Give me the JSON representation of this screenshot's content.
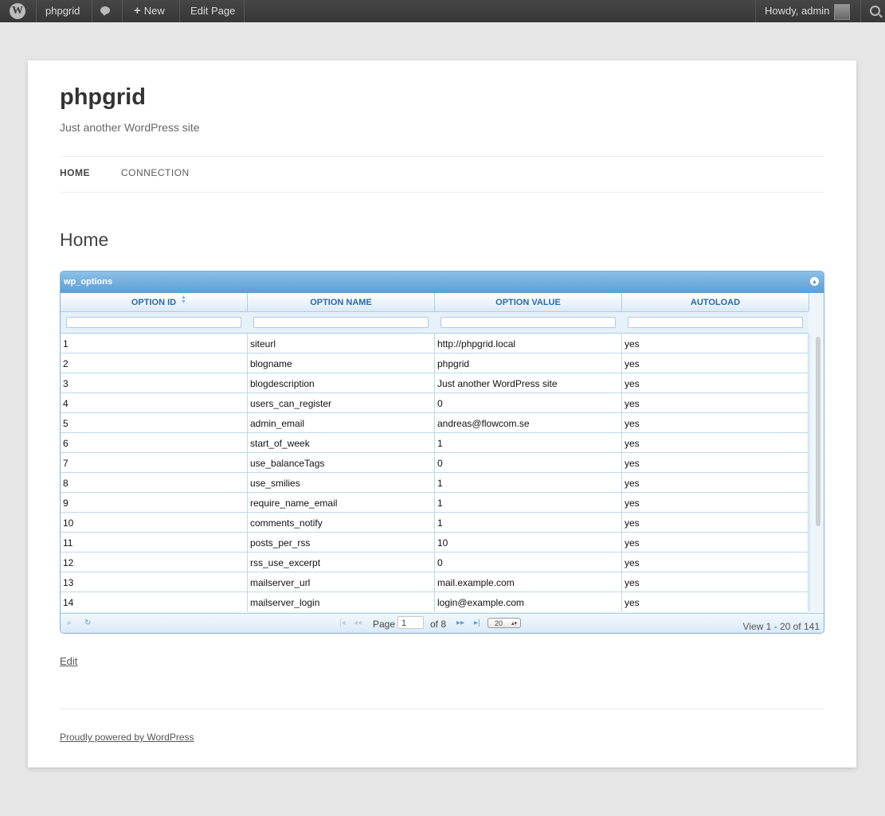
{
  "adminbar": {
    "site_name": "phpgrid",
    "new_label": "New",
    "edit_label": "Edit Page",
    "howdy_label": "Howdy, admin"
  },
  "site": {
    "title": "phpgrid",
    "description": "Just another WordPress site"
  },
  "nav": {
    "items": [
      "HOME",
      "CONNECTION"
    ]
  },
  "page": {
    "title": "Home",
    "edit_link": "Edit",
    "footer_text": "Proudly powered by WordPress"
  },
  "grid": {
    "caption": "wp_options",
    "columns": [
      "OPTION ID",
      "OPTION NAME",
      "OPTION VALUE",
      "AUTOLOAD"
    ],
    "rows": [
      [
        "1",
        "siteurl",
        "http://phpgrid.local",
        "yes"
      ],
      [
        "2",
        "blogname",
        "phpgrid",
        "yes"
      ],
      [
        "3",
        "blogdescription",
        "Just another WordPress site",
        "yes"
      ],
      [
        "4",
        "users_can_register",
        "0",
        "yes"
      ],
      [
        "5",
        "admin_email",
        "andreas@flowcom.se",
        "yes"
      ],
      [
        "6",
        "start_of_week",
        "1",
        "yes"
      ],
      [
        "7",
        "use_balanceTags",
        "0",
        "yes"
      ],
      [
        "8",
        "use_smilies",
        "1",
        "yes"
      ],
      [
        "9",
        "require_name_email",
        "1",
        "yes"
      ],
      [
        "10",
        "comments_notify",
        "1",
        "yes"
      ],
      [
        "11",
        "posts_per_rss",
        "10",
        "yes"
      ],
      [
        "12",
        "rss_use_excerpt",
        "0",
        "yes"
      ],
      [
        "13",
        "mailserver_url",
        "mail.example.com",
        "yes"
      ],
      [
        "14",
        "mailserver_login",
        "login@example.com",
        "yes"
      ]
    ],
    "pager": {
      "page_label": "Page",
      "current_page": "1",
      "of_label": "of 8",
      "rows_per_page": "20",
      "view_label": "View 1 - 20 of 141"
    }
  }
}
